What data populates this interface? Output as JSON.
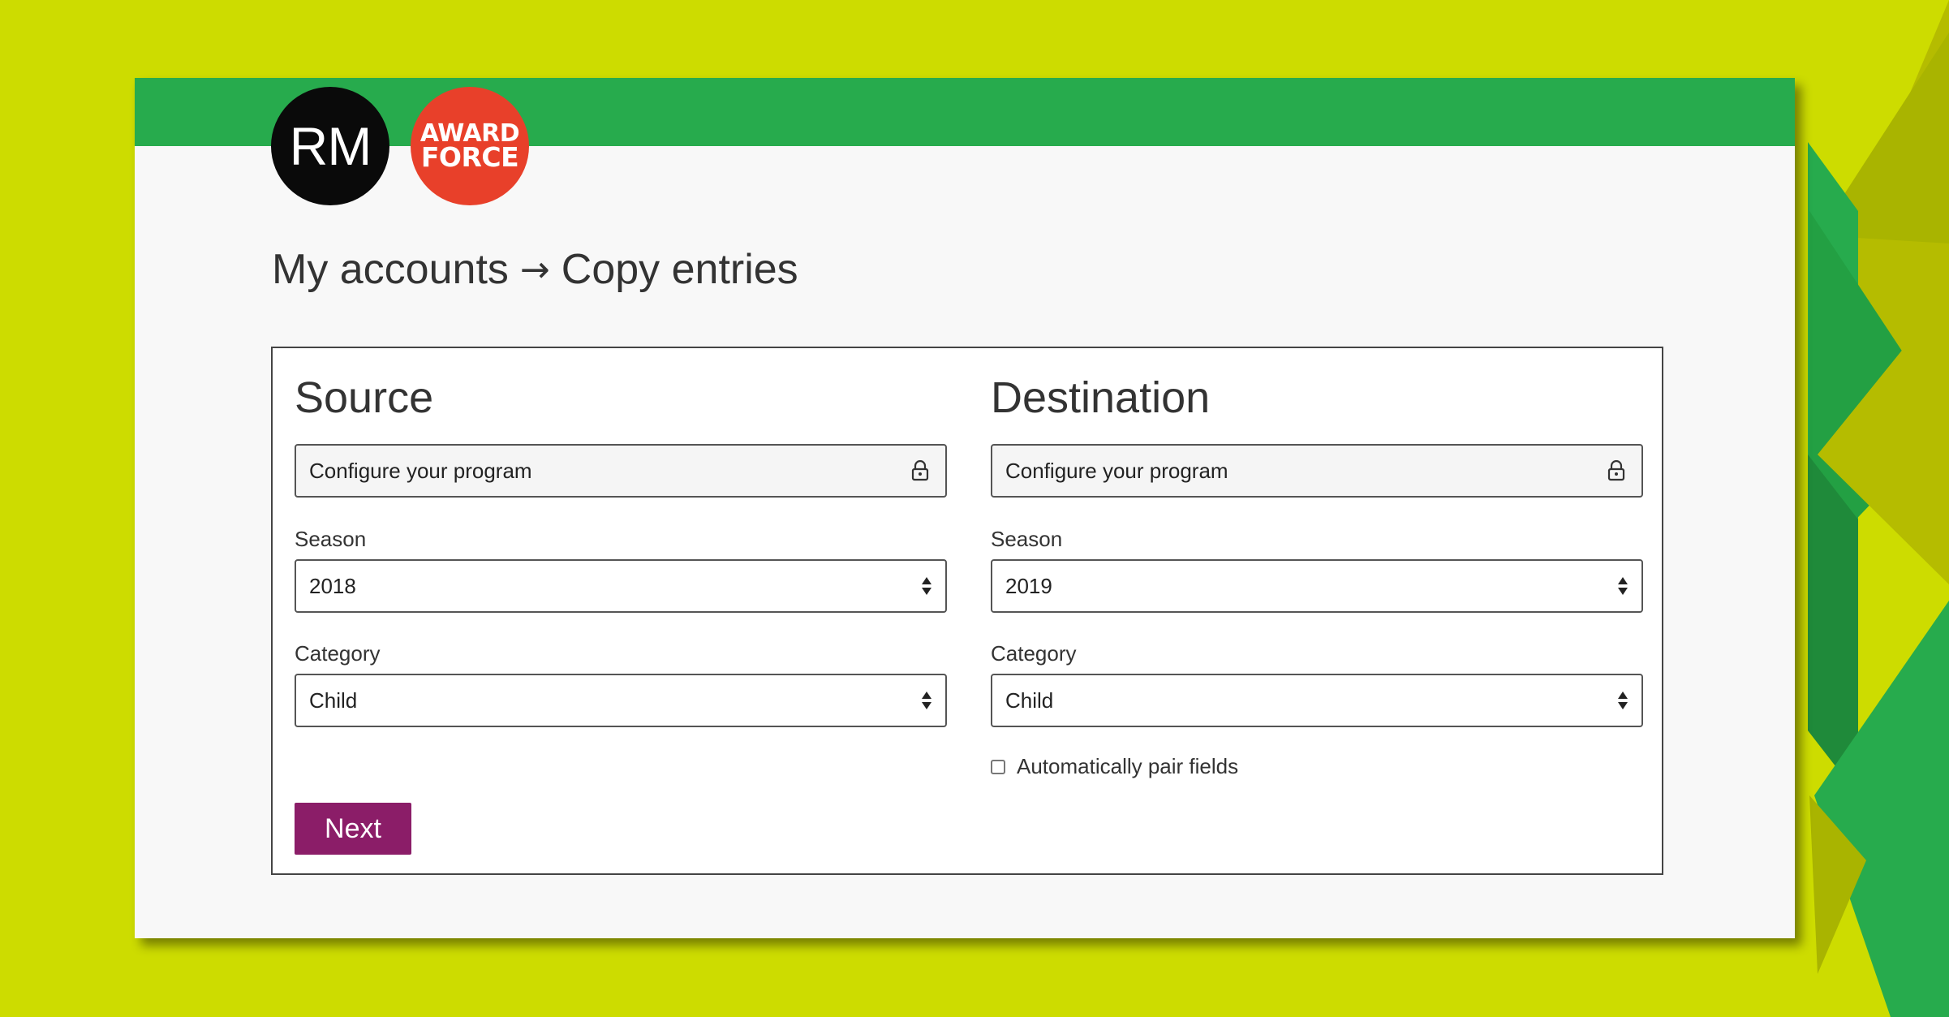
{
  "colors": {
    "background": "#cddc00",
    "header_bar": "#27ab4d",
    "avatar_bg": "#0a0a0a",
    "logo_bg": "#e8402a",
    "primary_button": "#8b1d68"
  },
  "header": {
    "avatar_initials": "RM",
    "logo_line1": "AWARD",
    "logo_line2": "FORCE"
  },
  "breadcrumb": {
    "parent": "My accounts",
    "separator": "→",
    "current": "Copy entries"
  },
  "source": {
    "heading": "Source",
    "program": "Configure your program",
    "program_icon": "lock-icon",
    "season_label": "Season",
    "season_value": "2018",
    "category_label": "Category",
    "category_value": "Child"
  },
  "destination": {
    "heading": "Destination",
    "program": "Configure your program",
    "program_icon": "lock-icon",
    "season_label": "Season",
    "season_value": "2019",
    "category_label": "Category",
    "category_value": "Child",
    "auto_pair_label": "Automatically pair fields",
    "auto_pair_checked": false
  },
  "actions": {
    "next_label": "Next"
  }
}
